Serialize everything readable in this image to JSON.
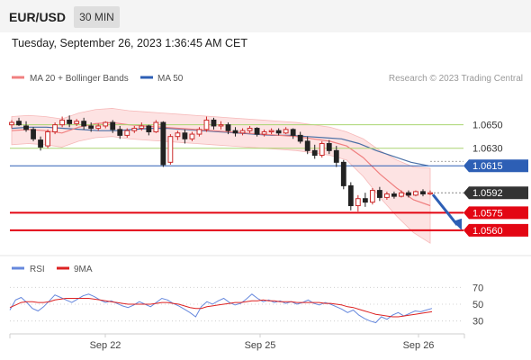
{
  "header": {
    "symbol": "EUR/USD",
    "timeframe": "30 MIN",
    "datetime": "Tuesday, September 26, 2023 1:36:45 AM CET"
  },
  "legend": {
    "ma20_label": "MA 20 + Bollinger Bands",
    "ma50_label": "MA 50",
    "copyright": "Research © 2023 Trading Central"
  },
  "rsi_legend": {
    "rsi_label": "RSI",
    "ma_label": "9MA"
  },
  "colors": {
    "bullish": "#cc2a2a",
    "bearish": "#222222",
    "ma20": "#f08080",
    "bollinger_fill": "#fde3e3",
    "ma50": "#4a6fa5",
    "resistance_green": "#aad470",
    "pivot_blue": "#2d5fb5",
    "support_red": "#e30613",
    "current_price_tag": "#333333",
    "arrow": "#2d5fb5",
    "rsi_line": "#6688dd",
    "rsi_ma": "#dd2222"
  },
  "chart_data": [
    {
      "type": "candlestick",
      "x_ticks": [
        "Sep 22",
        "Sep 25",
        "Sep 26"
      ],
      "ylim": [
        1.0553,
        1.0672
      ],
      "grid": false,
      "series": [
        {
          "name": "MA 20 + Bollinger Bands",
          "values": [
            1.0645,
            1.0646,
            1.0645,
            1.0643,
            1.0648,
            1.0651,
            1.0652,
            1.065,
            1.0649,
            1.0648,
            1.0647,
            1.0646,
            1.0645,
            1.0644,
            1.0643,
            1.0642,
            1.0641,
            1.064,
            1.0638,
            1.0636,
            1.0632,
            1.0622,
            1.0608,
            1.0596,
            1.0586,
            1.0581
          ]
        },
        {
          "name": "MA 50",
          "values": [
            1.0647,
            1.0648,
            1.0648,
            1.0647,
            1.0646,
            1.0645,
            1.0645,
            1.0646,
            1.0647,
            1.0647,
            1.0646,
            1.0645,
            1.0644,
            1.0643,
            1.0642,
            1.0641,
            1.0641,
            1.064,
            1.0639,
            1.0638,
            1.0634,
            1.0628,
            1.0623,
            1.0618,
            1.0615
          ]
        }
      ],
      "candles": [
        [
          1.065,
          1.0654,
          1.0652,
          1.0647
        ],
        [
          1.0653,
          1.0656,
          1.065,
          1.0649
        ],
        [
          1.0649,
          1.0653,
          1.0646,
          1.0644
        ],
        [
          1.0646,
          1.0648,
          1.0638,
          1.0636
        ],
        [
          1.0637,
          1.064,
          1.0631,
          1.0628
        ],
        [
          1.0632,
          1.0646,
          1.0644,
          1.063
        ],
        [
          1.0644,
          1.0652,
          1.065,
          1.0642
        ],
        [
          1.065,
          1.0657,
          1.0654,
          1.0648
        ],
        [
          1.0654,
          1.0658,
          1.0651,
          1.0648
        ],
        [
          1.0651,
          1.0655,
          1.0653,
          1.0649
        ],
        [
          1.0653,
          1.0656,
          1.0649,
          1.0646
        ],
        [
          1.0649,
          1.0652,
          1.0647,
          1.0644
        ],
        [
          1.0647,
          1.0651,
          1.0649,
          1.0645
        ],
        [
          1.0649,
          1.0653,
          1.0652,
          1.0647
        ],
        [
          1.0652,
          1.0654,
          1.0646,
          1.0643
        ],
        [
          1.0646,
          1.0649,
          1.0641,
          1.0638
        ],
        [
          1.0641,
          1.0647,
          1.0645,
          1.0639
        ],
        [
          1.0645,
          1.0649,
          1.0647,
          1.0643
        ],
        [
          1.0647,
          1.0652,
          1.0649,
          1.0645
        ],
        [
          1.0649,
          1.065,
          1.0644,
          1.0641
        ],
        [
          1.0644,
          1.0654,
          1.0652,
          1.0643
        ],
        [
          1.0652,
          1.0653,
          1.0616,
          1.0614
        ],
        [
          1.0618,
          1.0642,
          1.064,
          1.0616
        ],
        [
          1.064,
          1.0645,
          1.0643,
          1.0637
        ],
        [
          1.0643,
          1.0646,
          1.0638,
          1.0634
        ],
        [
          1.0638,
          1.0644,
          1.0642,
          1.0636
        ],
        [
          1.0642,
          1.0648,
          1.0646,
          1.064
        ],
        [
          1.0646,
          1.0657,
          1.0654,
          1.0644
        ],
        [
          1.0654,
          1.0656,
          1.0649,
          1.0646
        ],
        [
          1.0649,
          1.0653,
          1.065,
          1.0646
        ],
        [
          1.065,
          1.0652,
          1.0645,
          1.0642
        ],
        [
          1.0645,
          1.0648,
          1.0643,
          1.064
        ],
        [
          1.0643,
          1.0647,
          1.0645,
          1.0641
        ],
        [
          1.0645,
          1.0649,
          1.0647,
          1.0643
        ],
        [
          1.0647,
          1.0648,
          1.0642,
          1.064
        ],
        [
          1.0642,
          1.0646,
          1.0644,
          1.064
        ],
        [
          1.0644,
          1.0647,
          1.0645,
          1.0642
        ],
        [
          1.0645,
          1.0647,
          1.0643,
          1.0641
        ],
        [
          1.0643,
          1.0648,
          1.0646,
          1.0642
        ],
        [
          1.0646,
          1.0647,
          1.0641,
          1.0638
        ],
        [
          1.0641,
          1.0644,
          1.0636,
          1.0634
        ],
        [
          1.0636,
          1.064,
          1.0628,
          1.0625
        ],
        [
          1.0628,
          1.0633,
          1.0624,
          1.0621
        ],
        [
          1.0624,
          1.0636,
          1.0634,
          1.0622
        ],
        [
          1.0634,
          1.0637,
          1.0628,
          1.0625
        ],
        [
          1.0628,
          1.0632,
          1.0618,
          1.0614
        ],
        [
          1.0618,
          1.062,
          1.0598,
          1.0595
        ],
        [
          1.0598,
          1.0601,
          1.0581,
          1.0577
        ],
        [
          1.0581,
          1.059,
          1.0587,
          1.0576
        ],
        [
          1.0587,
          1.0592,
          1.0584,
          1.058
        ],
        [
          1.0584,
          1.0596,
          1.0594,
          1.0582
        ],
        [
          1.0594,
          1.0597,
          1.0588,
          1.0585
        ],
        [
          1.0588,
          1.0593,
          1.0591,
          1.0586
        ],
        [
          1.0591,
          1.0593,
          1.0589,
          1.0587
        ],
        [
          1.0589,
          1.0594,
          1.0592,
          1.0588
        ],
        [
          1.0592,
          1.0594,
          1.059,
          1.0588
        ],
        [
          1.059,
          1.0594,
          1.0593,
          1.0589
        ],
        [
          1.0593,
          1.0595,
          1.0591,
          1.0589
        ],
        [
          1.0591,
          1.0594,
          1.0592,
          1.059
        ]
      ],
      "levels": [
        {
          "label": "1.0650",
          "value": 1.065,
          "style": "resistance"
        },
        {
          "label": "1.0630",
          "value": 1.063,
          "style": "resistance"
        },
        {
          "label": "1.0615",
          "value": 1.0615,
          "style": "pivot"
        },
        {
          "label": "1.0592",
          "value": 1.0592,
          "style": "current"
        },
        {
          "label": "1.0575",
          "value": 1.0575,
          "style": "support"
        },
        {
          "label": "1.0560",
          "value": 1.056,
          "style": "support"
        }
      ]
    },
    {
      "type": "line",
      "ylabel": "",
      "ylim": [
        20,
        80
      ],
      "y_ticks": [
        70,
        50,
        30
      ],
      "series": [
        {
          "name": "RSI",
          "values": [
            43,
            55,
            58,
            52,
            45,
            42,
            47,
            54,
            61,
            58,
            55,
            52,
            56,
            60,
            62,
            59,
            55,
            52,
            54,
            51,
            48,
            46,
            49,
            53,
            50,
            47,
            52,
            57,
            55,
            51,
            48,
            44,
            40,
            35,
            47,
            53,
            50,
            54,
            57,
            52,
            49,
            51,
            56,
            62,
            57,
            53,
            55,
            52,
            54,
            51,
            53,
            50,
            52,
            55,
            51,
            49,
            52,
            50,
            47,
            44,
            40,
            43,
            37,
            33,
            30,
            28,
            35,
            32,
            37,
            40,
            36,
            39,
            42,
            41,
            43,
            45
          ]
        },
        {
          "name": "9MA",
          "values": [
            46,
            49,
            52,
            53,
            53,
            52,
            52,
            53,
            55,
            56,
            57,
            57,
            57,
            57,
            57,
            56,
            55,
            54,
            53,
            52,
            51,
            50,
            50,
            50,
            50,
            50,
            51,
            52,
            52,
            51,
            50,
            48,
            46,
            45,
            45,
            47,
            48,
            49,
            50,
            51,
            52,
            52,
            53,
            54,
            54,
            55,
            54,
            54,
            53,
            53,
            53,
            52,
            52,
            52,
            52,
            52,
            51,
            51,
            50,
            49,
            47,
            46,
            44,
            42,
            40,
            38,
            37,
            36,
            35,
            35,
            36,
            37,
            38,
            39,
            40,
            41
          ]
        }
      ]
    }
  ]
}
